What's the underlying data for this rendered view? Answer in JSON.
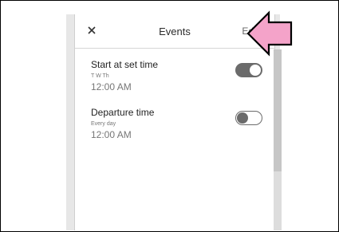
{
  "header": {
    "title": "Events",
    "edit_label": "Edit",
    "close_icon": "close-icon"
  },
  "events": [
    {
      "label": "Start at set time",
      "days": "T W Th",
      "time": "12:00 AM",
      "enabled": true
    },
    {
      "label": "Departure time",
      "days": "Every day",
      "time": "12:00 AM",
      "enabled": false
    }
  ],
  "annotation": {
    "icon": "pointer-arrow-icon",
    "color": "#f4a3c9"
  }
}
